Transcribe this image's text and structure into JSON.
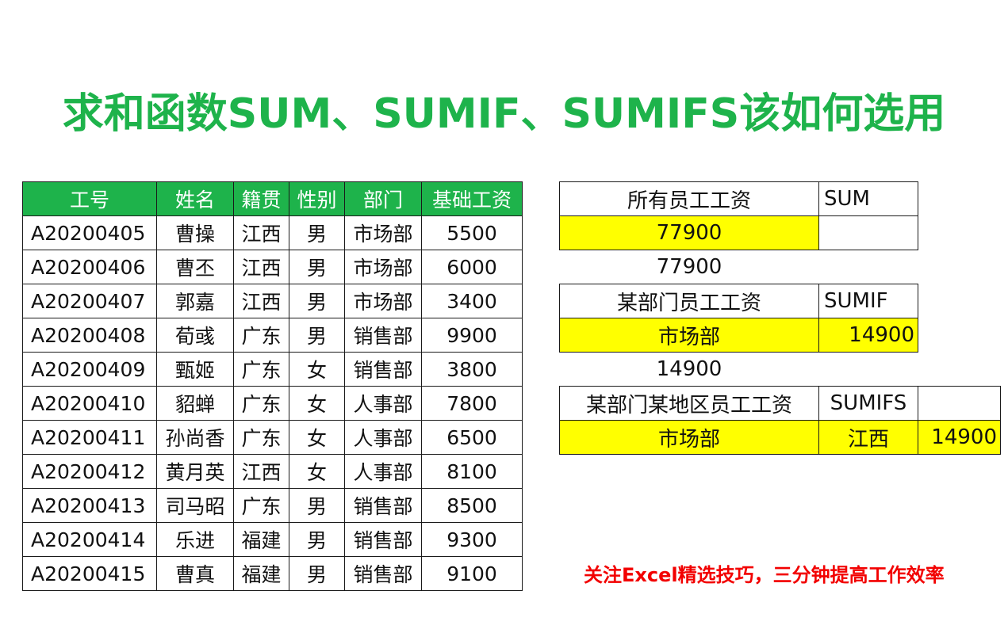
{
  "title": "求和函数SUM、SUMIF、SUMIFS该如何选用",
  "employee_table": {
    "headers": [
      "工号",
      "姓名",
      "籍贯",
      "性别",
      "部门",
      "基础工资"
    ],
    "rows": [
      [
        "A20200405",
        "曹操",
        "江西",
        "男",
        "市场部",
        "5500"
      ],
      [
        "A20200406",
        "曹丕",
        "江西",
        "男",
        "市场部",
        "6000"
      ],
      [
        "A20200407",
        "郭嘉",
        "江西",
        "男",
        "市场部",
        "3400"
      ],
      [
        "A20200408",
        "荀彧",
        "广东",
        "男",
        "销售部",
        "9900"
      ],
      [
        "A20200409",
        "甄姬",
        "广东",
        "女",
        "销售部",
        "3800"
      ],
      [
        "A20200410",
        "貂蝉",
        "广东",
        "女",
        "人事部",
        "7800"
      ],
      [
        "A20200411",
        "孙尚香",
        "广东",
        "女",
        "人事部",
        "6500"
      ],
      [
        "A20200412",
        "黄月英",
        "江西",
        "女",
        "人事部",
        "8100"
      ],
      [
        "A20200413",
        "司马昭",
        "广东",
        "男",
        "销售部",
        "8500"
      ],
      [
        "A20200414",
        "乐进",
        "福建",
        "男",
        "销售部",
        "9300"
      ],
      [
        "A20200415",
        "曹真",
        "福建",
        "男",
        "销售部",
        "9100"
      ]
    ]
  },
  "sum_block": {
    "label": "所有员工工资",
    "func": "SUM",
    "result": "77900",
    "check": "77900"
  },
  "sumif_block": {
    "label": "某部门员工工资",
    "func": "SUMIF",
    "criteria": "市场部",
    "result": "14900",
    "check": "14900"
  },
  "sumifs_block": {
    "label": "某部门某地区员工工资",
    "func": "SUMIFS",
    "criteria1": "市场部",
    "criteria2": "江西",
    "result": "14900"
  },
  "footer": "关注Excel精选技巧，三分钟提高工作效率",
  "colors": {
    "accent_green": "#1eb34b",
    "highlight_yellow": "#ffff00",
    "footer_red": "#f20000"
  }
}
